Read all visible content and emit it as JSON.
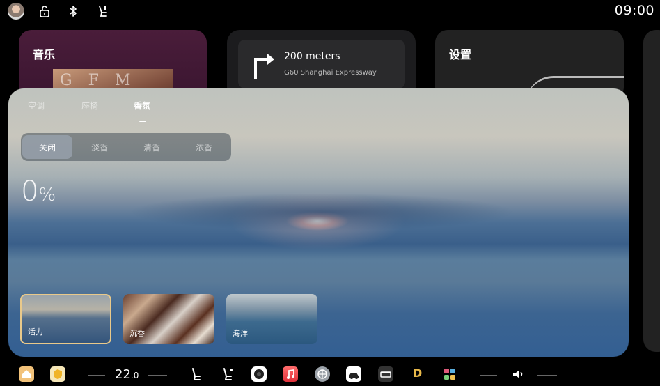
{
  "status_bar": {
    "time": "09:00",
    "icons": [
      "avatar",
      "lock-open-icon",
      "bluetooth-icon",
      "seat-icon"
    ]
  },
  "cards": {
    "music": {
      "title": "音乐",
      "album_text": "G  F  M"
    },
    "navigation": {
      "distance": "200 meters",
      "road": "G60 Shanghai Expressway",
      "maneuver": "turn-right-arrow-icon"
    },
    "settings": {
      "title": "设置"
    }
  },
  "fragrance_panel": {
    "tabs": [
      {
        "label": "空调",
        "active": false
      },
      {
        "label": "座椅",
        "active": false
      },
      {
        "label": "香氛",
        "active": true
      }
    ],
    "intensity_options": [
      {
        "label": "关闭",
        "active": true
      },
      {
        "label": "淡香",
        "active": false
      },
      {
        "label": "清香",
        "active": false
      },
      {
        "label": "浓香",
        "active": false
      }
    ],
    "level_value": "0",
    "level_unit": "%",
    "scents": [
      {
        "label": "活力",
        "selected": true
      },
      {
        "label": "沉香",
        "selected": false
      },
      {
        "label": "海洋",
        "selected": false
      }
    ]
  },
  "dock": {
    "temperature_int": "22",
    "temperature_dec": ".0",
    "gear": "D",
    "icons": [
      "home-icon",
      "shield-app-icon",
      "seat-left-icon",
      "seat-right-icon",
      "camera-icon",
      "music-app-icon",
      "browser-icon",
      "car-app-icon",
      "dashcam-icon",
      "apps-grid-icon",
      "volume-icon"
    ]
  },
  "colors": {
    "accent_selected_border": "#e9c98a",
    "music_card": "#4a1d3a",
    "gear": "#e8b84a"
  }
}
